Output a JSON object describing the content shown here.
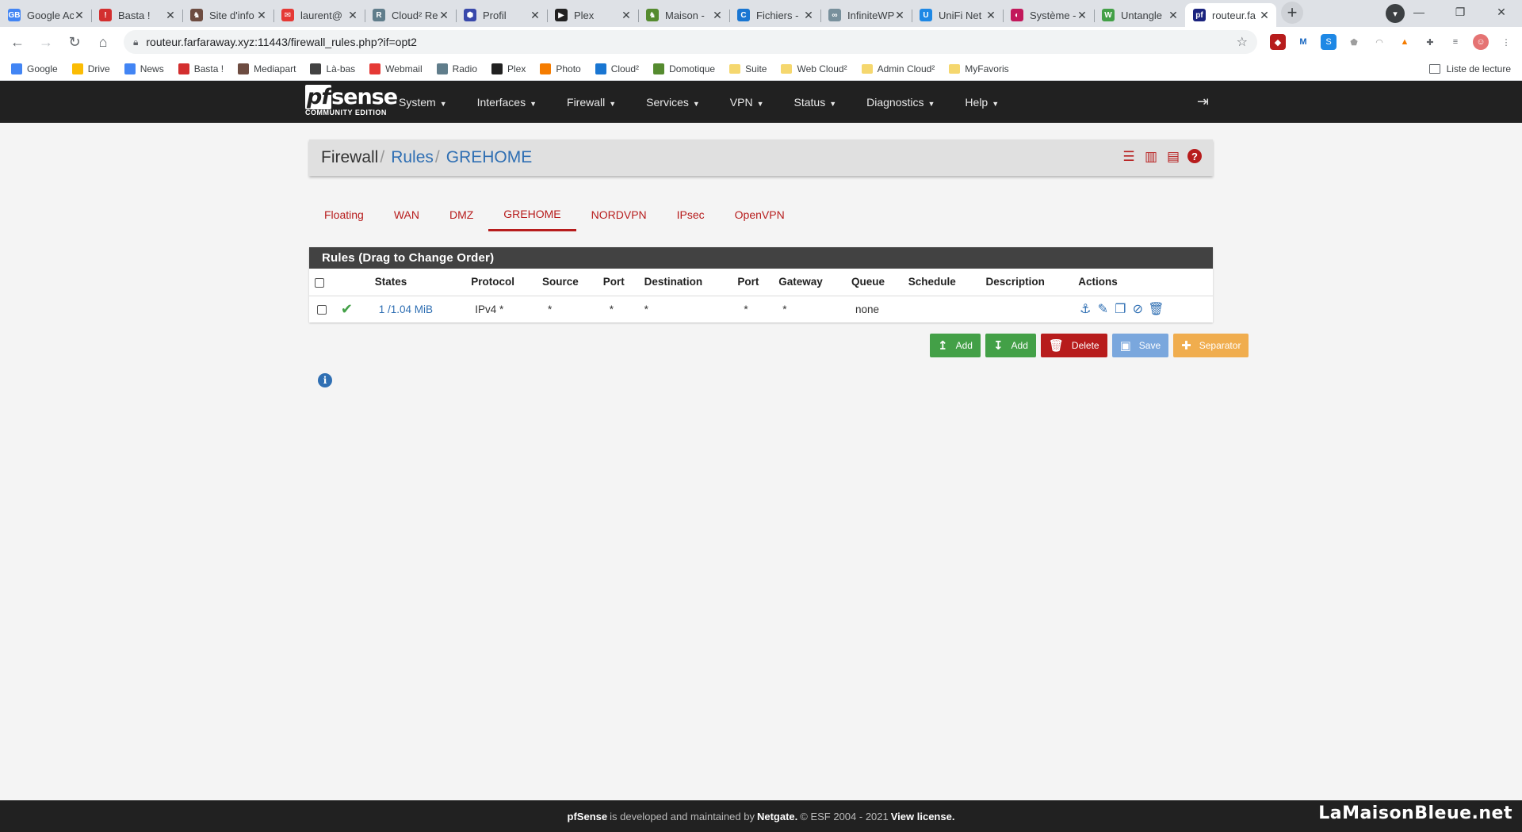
{
  "browser": {
    "tabs": [
      {
        "title": "Google Ac",
        "fav_color": "#4285f4",
        "fav_text": "GB"
      },
      {
        "title": "Basta !",
        "fav_color": "#d32f2f",
        "fav_text": "!"
      },
      {
        "title": "Site d'info",
        "fav_color": "#6d4c41",
        "fav_text": "♞"
      },
      {
        "title": "laurent@",
        "fav_color": "#e53935",
        "fav_text": "✉"
      },
      {
        "title": "Cloud² Re",
        "fav_color": "#607d8b",
        "fav_text": "R"
      },
      {
        "title": "Profil",
        "fav_color": "#3949ab",
        "fav_text": "⬢"
      },
      {
        "title": "Plex",
        "fav_color": "#212121",
        "fav_text": "▶"
      },
      {
        "title": "Maison -",
        "fav_color": "#558b2f",
        "fav_text": "♞"
      },
      {
        "title": "Fichiers -",
        "fav_color": "#1976d2",
        "fav_text": "C"
      },
      {
        "title": "InfiniteWP",
        "fav_color": "#78909c",
        "fav_text": "∞"
      },
      {
        "title": "UniFi Net",
        "fav_color": "#1e88e5",
        "fav_text": "U"
      },
      {
        "title": "Système -",
        "fav_color": "#c2185b",
        "fav_text": "◐"
      },
      {
        "title": "Untangle",
        "fav_color": "#43a047",
        "fav_text": "W"
      },
      {
        "title": "routeur.fa",
        "fav_color": "#1a237e",
        "fav_text": "pf"
      }
    ],
    "new_tab": "+",
    "url": "routeur.farfaraway.xyz:11443/firewall_rules.php?if=opt2",
    "bookmarks": [
      {
        "label": "Google",
        "color": "#4285f4"
      },
      {
        "label": "Drive",
        "color": "#fbbc04"
      },
      {
        "label": "News",
        "color": "#4285f4"
      },
      {
        "label": "Basta !",
        "color": "#d32f2f"
      },
      {
        "label": "Mediapart",
        "color": "#6d4c41"
      },
      {
        "label": "Là-bas",
        "color": "#424242"
      },
      {
        "label": "Webmail",
        "color": "#e53935"
      },
      {
        "label": "Radio",
        "color": "#607d8b"
      },
      {
        "label": "Plex",
        "color": "#212121"
      },
      {
        "label": "Photo",
        "color": "#f57c00"
      },
      {
        "label": "Cloud²",
        "color": "#1976d2"
      },
      {
        "label": "Domotique",
        "color": "#558b2f"
      }
    ],
    "bookmark_folders": [
      "Suite",
      "Web Cloud²",
      "Admin Cloud²",
      "MyFavoris"
    ],
    "reading_list": "Liste de lecture"
  },
  "pfsense": {
    "brand": {
      "logo_pf": "pf",
      "logo_rest": "sense",
      "edition": "COMMUNITY EDITION"
    },
    "menu": [
      "System",
      "Interfaces",
      "Firewall",
      "Services",
      "VPN",
      "Status",
      "Diagnostics",
      "Help"
    ],
    "breadcrumb": {
      "level1": "Firewall",
      "level2": "Rules",
      "level3": "GREHOME",
      "separator": "/"
    },
    "interface_tabs": [
      "Floating",
      "WAN",
      "DMZ",
      "GREHOME",
      "NORDVPN",
      "IPsec",
      "OpenVPN"
    ],
    "active_tab": "GREHOME",
    "panel_title": "Rules (Drag to Change Order)",
    "columns": [
      "States",
      "Protocol",
      "Source",
      "Port",
      "Destination",
      "Port",
      "Gateway",
      "Queue",
      "Schedule",
      "Description",
      "Actions"
    ],
    "rules": [
      {
        "states": "1 /1.04 MiB",
        "protocol": "IPv4 *",
        "source": "*",
        "source_port": "*",
        "destination": "*",
        "destination_port": "*",
        "gateway": "*",
        "queue": "none",
        "schedule": "",
        "description": ""
      }
    ],
    "buttons": {
      "add_top": "Add",
      "add_bottom": "Add",
      "delete": "Delete",
      "save": "Save",
      "separator": "Separator"
    },
    "footer": {
      "pfsense": "pfSense",
      "text1": "is developed and maintained by",
      "netgate": "Netgate.",
      "copyright": "© ESF 2004 - 2021",
      "license": "View license."
    }
  },
  "watermark": "LaMaisonBleue.net",
  "colors": {
    "brand_red": "#b71c1c",
    "link_blue": "#2f6fb3",
    "success_green": "#43a047",
    "nav_dark": "#212121"
  }
}
